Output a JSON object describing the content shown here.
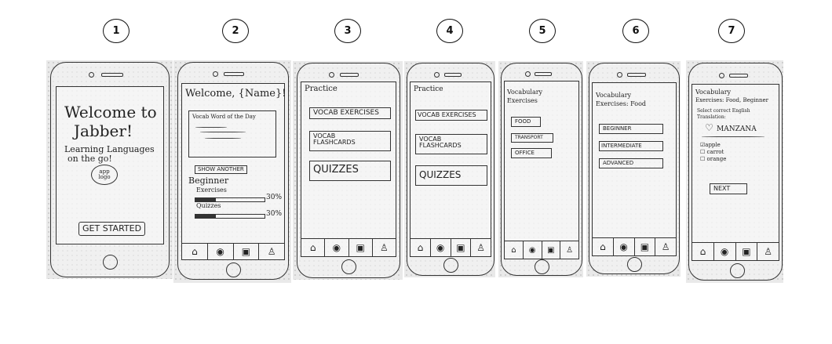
{
  "step_numbers": [
    "1",
    "2",
    "3",
    "4",
    "5",
    "6",
    "7"
  ],
  "icons": {
    "home": "home-icon",
    "play": "play-circle-icon",
    "flashcards": "flashcards-icon",
    "profile": "profile-icon",
    "heart": "heart-icon"
  },
  "screen1": {
    "title_line1": "Welcome to",
    "title_line2": "Jabber!",
    "tagline_line1": "Learning Languages",
    "tagline_line2": "on the go!",
    "logo_line1": "app",
    "logo_line2": "logo",
    "cta": "GET STARTED"
  },
  "screen2": {
    "greeting": "Welcome, {Name}!",
    "wotd": "Vocab Word of the Day",
    "show_another": "SHOW ANOTHER",
    "level": "Beginner",
    "exercises_label": "Exercises",
    "exercises_pct": "30%",
    "exercises_progress": 0.3,
    "quizzes_label": "Quizzes",
    "quizzes_pct": "30%",
    "quizzes_progress": 0.3
  },
  "screen3": {
    "title": "Practice",
    "btn1": "VOCAB EXERCISES",
    "btn2_line1": "VOCAB",
    "btn2_line2": "FLASHCARDS",
    "btn3": "QUIZZES"
  },
  "screen4": {
    "title": "Practice",
    "btn1": "VOCAB EXERCISES",
    "btn2_line1": "VOCAB",
    "btn2_line2": "FLASHCARDS",
    "btn3": "QUIZZES"
  },
  "screen5": {
    "title_line1": "Vocabulary",
    "title_line2": "Exercises",
    "cats": [
      "FOOD",
      "TRANSPORT",
      "OFFICE"
    ]
  },
  "screen6": {
    "title_line1": "Vocabulary",
    "title_line2": "Exercises: Food",
    "levels": [
      "BEGINNER",
      "INTERMEDIATE",
      "ADVANCED"
    ]
  },
  "screen7": {
    "title_line1": "Vocabulary",
    "title_line2": "Exercises: Food, Beginner",
    "instr_line1": "Select correct English",
    "instr_line2": "Translation:",
    "word": "MANZANA",
    "options": [
      "apple",
      "carrot",
      "orange"
    ],
    "next": "NEXT"
  }
}
